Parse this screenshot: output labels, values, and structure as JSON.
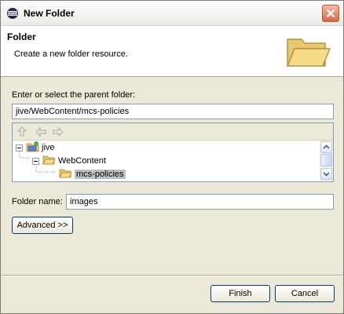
{
  "window": {
    "title": "New Folder"
  },
  "banner": {
    "title": "Folder",
    "description": "Create a new folder resource."
  },
  "parent": {
    "label": "Enter or select the parent folder:",
    "value": "jive/WebContent/mcs-policies"
  },
  "toolbar": {
    "icons": [
      "go-up-icon",
      "back-arrow-icon",
      "forward-arrow-icon"
    ]
  },
  "tree": {
    "items": [
      {
        "label": "jive",
        "level": 0,
        "expanded": true
      },
      {
        "label": "WebContent",
        "level": 1,
        "expanded": true
      },
      {
        "label": "mcs-policies",
        "level": 2,
        "selected": true
      }
    ]
  },
  "folder_name": {
    "label": "Folder name:",
    "value": "images"
  },
  "buttons": {
    "advanced": "Advanced >>",
    "finish": "Finish",
    "cancel": "Cancel"
  },
  "colors": {
    "window_bg": "#ece9d8",
    "field_border": "#7f9db9",
    "button_border": "#003c74",
    "selection": "#c0c0c0"
  }
}
